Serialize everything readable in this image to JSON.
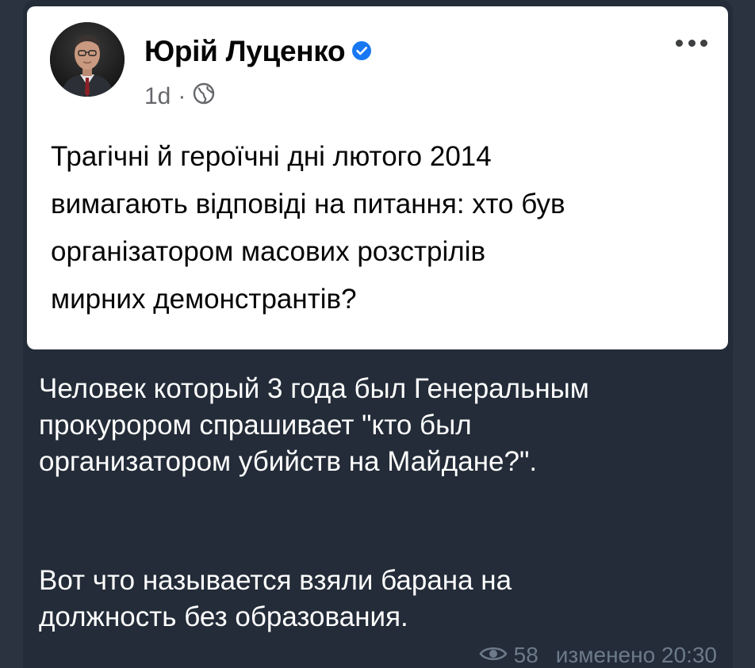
{
  "post": {
    "author": "Юрій Луценко",
    "time": "1d",
    "separator": "·",
    "text_lines": [
      "Трагічні й героїчні дні лютого 2014",
      "вимагають відповіді на питання: хто був",
      "організатором масових розстрілів",
      "мирних демонстрантів?"
    ]
  },
  "message": {
    "paragraph1_lines": [
      "Человек который 3 года был Генеральным",
      "прокурором спрашивает \"кто был",
      "организатором убийств на Майдане?\"."
    ],
    "paragraph2_lines": [
      "Вот что называется взяли барана на",
      "должность без образования."
    ],
    "views": "58",
    "edited_label": "изменено 20:30"
  },
  "icons": {
    "verified": "verified-badge-icon",
    "globe": "globe-icon",
    "more": "more-options-icon",
    "views": "eye-icon"
  },
  "colors": {
    "background": "#2b3340",
    "bubble": "#232c38",
    "card": "#ffffff",
    "verified": "#1877f2",
    "meta_text": "#6d7a8a"
  }
}
